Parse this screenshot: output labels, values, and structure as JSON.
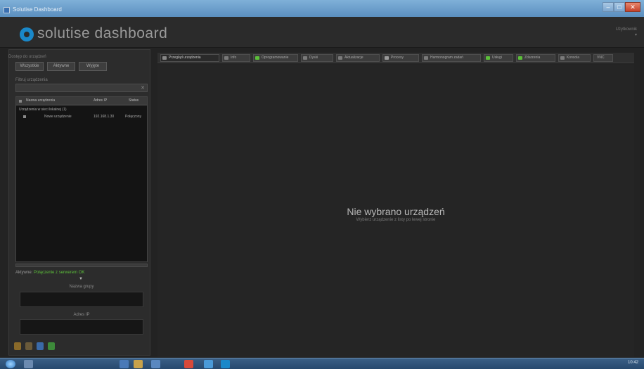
{
  "window": {
    "title": "Solutise Dashboard",
    "minimize_glyph": "–",
    "maximize_glyph": "□",
    "close_glyph": "✕"
  },
  "header": {
    "app_name": "solutise dashboard",
    "user_line1": "Użytkownik",
    "user_line2": "▾",
    "brand_color": "#1a88c9"
  },
  "left_panel": {
    "section_label": "Dostęp do urządzeń",
    "buttons": [
      "Wszystkie",
      "Aktywne",
      "Wyjęte"
    ],
    "filter_label": "Filtruj urządzenia",
    "search_placeholder": "",
    "search_clear_glyph": "✕",
    "columns": [
      "Nazwa urządzenia",
      "Adres IP",
      "Status"
    ],
    "rows": [
      {
        "label": "Urządzenia w sieci lokalnej (1)",
        "ip": "",
        "status": ""
      },
      {
        "label": "Nowe urządzenie",
        "ip": "192.168.1.30",
        "status": "Połączony"
      }
    ],
    "status_label": "Aktywne:",
    "status_value": "Połączenie z serwerem OK",
    "status_ok_color": "#5cbf3a",
    "expand_glyph": "▼",
    "field1_label": "Nazwa grupy",
    "field2_label": "Adres IP"
  },
  "tabs": [
    {
      "label": "Przegląd urządzenia",
      "color": "#888888"
    },
    {
      "label": "Info",
      "color": "#7a7a7a"
    },
    {
      "label": "Oprogramowanie",
      "color": "#5cbf3a"
    },
    {
      "label": "Dyski",
      "color": "#7a7a7a"
    },
    {
      "label": "Aktualizacje",
      "color": "#7a7a7a"
    },
    {
      "label": "Procesy",
      "color": "#9a9a9a"
    },
    {
      "label": "Harmonogram zadań",
      "color": "#7a7a7a"
    },
    {
      "label": "Usługi",
      "color": "#5cbf3a"
    },
    {
      "label": "Zdarzenia",
      "color": "#5cbf3a"
    },
    {
      "label": "Konsola",
      "color": "#7a7a7a"
    },
    {
      "label": "VNC",
      "color": ""
    }
  ],
  "main": {
    "empty_title": "Nie wybrano urządzeń",
    "empty_subtitle": "Wybierz urządzenie z listy po lewej stronie"
  },
  "taskbar": {
    "clock": "10:42",
    "apps": [
      "explorer",
      "browser",
      "mail",
      "media",
      "chrome",
      "app",
      "dashboard"
    ]
  }
}
